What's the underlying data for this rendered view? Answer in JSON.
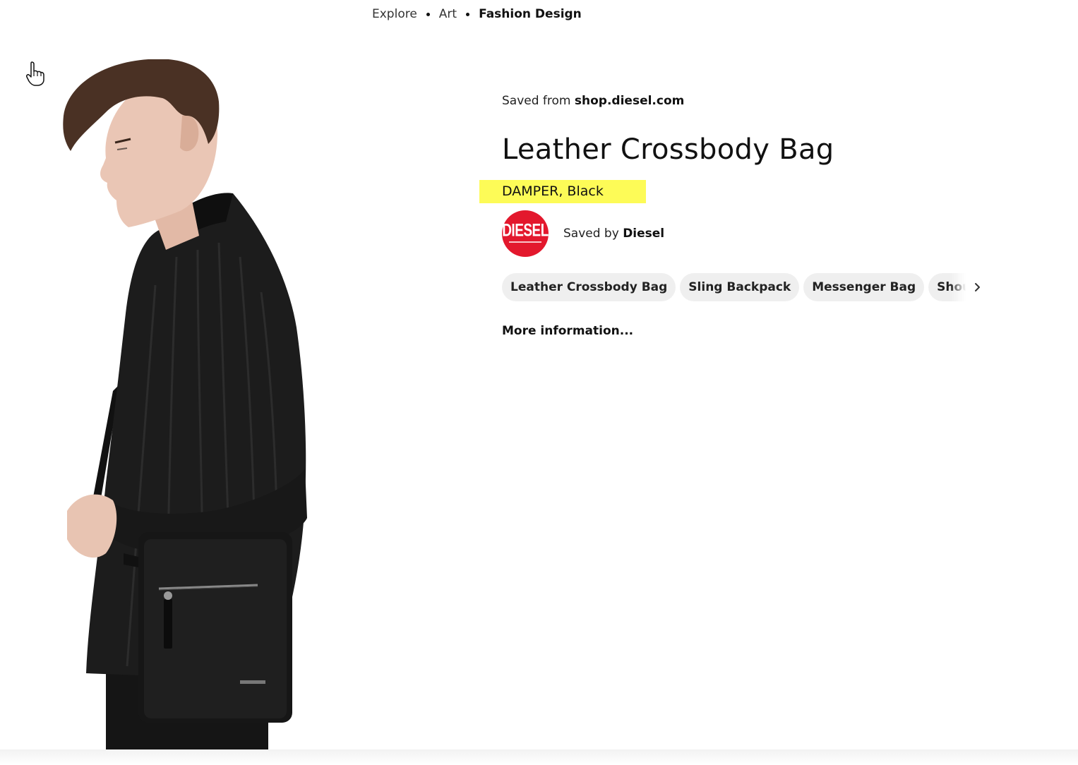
{
  "breadcrumb": {
    "items": [
      "Explore",
      "Art"
    ],
    "current": "Fashion Design"
  },
  "pin": {
    "saved_from_prefix": "Saved from",
    "saved_from_domain": "shop.diesel.com",
    "title": "Leather Crossbody Bag",
    "subtitle": "DAMPER, Black",
    "saved_by_prefix": "Saved by",
    "saved_by_name": "Diesel",
    "avatar_brand": "DIESEL",
    "more_info": "More information...",
    "tags": [
      "Leather Crossbody Bag",
      "Sling Backpack",
      "Messenger Bag",
      "Shoulder S"
    ]
  },
  "icons": {
    "cursor": "hand-pointer-icon",
    "tags_next": "chevron-right-icon"
  },
  "colors": {
    "highlight": "#fdfb57",
    "brand_red": "#e3182d",
    "tag_bg": "#efefef"
  }
}
